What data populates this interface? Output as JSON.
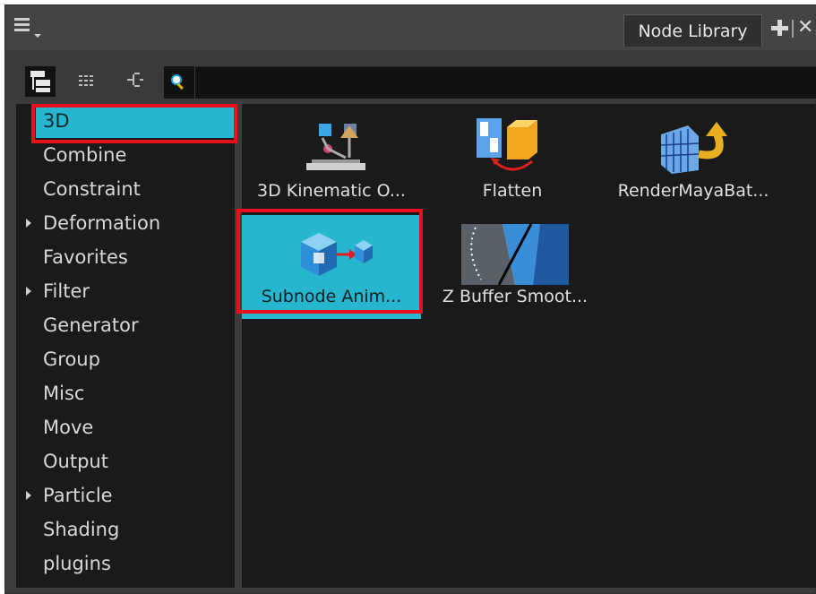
{
  "window": {
    "menu_icon": "hamburger-menu-icon",
    "tab_title": "Node Library",
    "tab_add_icon": "plus-icon",
    "tab_close_icon": "close-icon"
  },
  "toolbar": {
    "tools": [
      {
        "name": "tree-view-icon",
        "active": true
      },
      {
        "name": "list-view-icon",
        "active": false
      },
      {
        "name": "hierarchy-view-icon",
        "active": false
      },
      {
        "name": "search-icon",
        "active": false
      }
    ],
    "search_value": ""
  },
  "categories": [
    {
      "label": "3D",
      "expandable": false,
      "selected": true
    },
    {
      "label": "Combine",
      "expandable": false,
      "selected": false
    },
    {
      "label": "Constraint",
      "expandable": false,
      "selected": false
    },
    {
      "label": "Deformation",
      "expandable": true,
      "selected": false
    },
    {
      "label": "Favorites",
      "expandable": false,
      "selected": false
    },
    {
      "label": "Filter",
      "expandable": true,
      "selected": false
    },
    {
      "label": "Generator",
      "expandable": false,
      "selected": false
    },
    {
      "label": "Group",
      "expandable": false,
      "selected": false
    },
    {
      "label": "Misc",
      "expandable": false,
      "selected": false
    },
    {
      "label": "Move",
      "expandable": false,
      "selected": false
    },
    {
      "label": "Output",
      "expandable": false,
      "selected": false
    },
    {
      "label": "Particle",
      "expandable": true,
      "selected": false
    },
    {
      "label": "Shading",
      "expandable": false,
      "selected": false
    },
    {
      "label": "plugins",
      "expandable": false,
      "selected": false
    }
  ],
  "nodes": [
    {
      "label": "3D Kinematic O...",
      "icon": "kinematic-output-icon",
      "selected": false
    },
    {
      "label": "Flatten",
      "icon": "flatten-icon",
      "selected": false
    },
    {
      "label": "RenderMayaBat...",
      "icon": "render-maya-batch-icon",
      "selected": false
    },
    {
      "label": "Subnode Anim...",
      "icon": "subnode-animation-icon",
      "selected": true
    },
    {
      "label": "Z Buffer Smoot...",
      "icon": "z-buffer-smoothing-icon",
      "selected": false
    }
  ],
  "colors": {
    "selection": "#27b6cf",
    "highlight_box": "#e8101b",
    "panel_bg": "#1a1a1a"
  }
}
